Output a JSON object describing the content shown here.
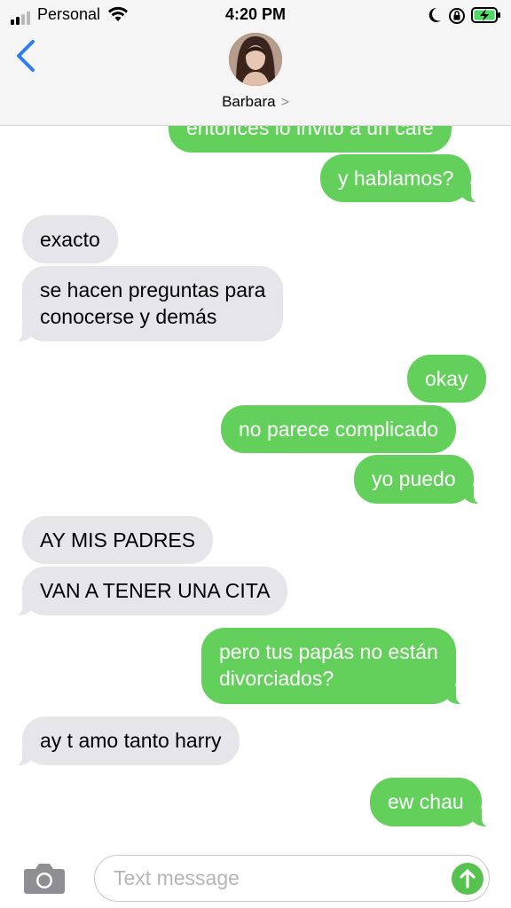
{
  "status_bar": {
    "carrier": "Personal",
    "time": "4:20 PM",
    "signal_bars": 4,
    "signal_bars_filled": 2,
    "battery": "charging"
  },
  "header": {
    "contact_name": "Barbara",
    "chevron": ">"
  },
  "messages": [
    {
      "text": "entonces lo invito a un café",
      "direction": "outgoing"
    },
    {
      "text": "y hablamos?",
      "direction": "outgoing"
    },
    {
      "text": "exacto",
      "direction": "incoming"
    },
    {
      "text_line1": "se hacen preguntas para",
      "text_line2": "conocerse y demás",
      "direction": "incoming"
    },
    {
      "text": "okay",
      "direction": "outgoing"
    },
    {
      "text": "no parece complicado",
      "direction": "outgoing"
    },
    {
      "text": "yo puedo",
      "direction": "outgoing"
    },
    {
      "text": "AY MIS PADRES",
      "direction": "incoming"
    },
    {
      "text": "VAN A TENER UNA CITA",
      "direction": "incoming"
    },
    {
      "text_line1": "pero tus papás no están",
      "text_line2": "divorciados?",
      "direction": "outgoing"
    },
    {
      "text": "ay t amo tanto harry",
      "direction": "incoming"
    },
    {
      "text": "ew chau",
      "direction": "outgoing"
    }
  ],
  "composer": {
    "placeholder": "Text message"
  },
  "colors": {
    "outgoing_bubble": "#64d05c",
    "incoming_bubble": "#e6e5ea",
    "accent": "#2f7cf6",
    "send_button": "#57c24d"
  }
}
